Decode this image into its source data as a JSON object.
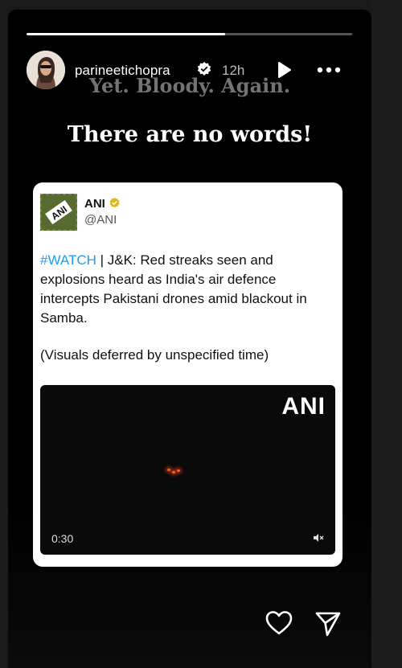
{
  "story": {
    "username": "parineetichopra",
    "time": "12h",
    "progress": 0.61,
    "caption_top": "Yet. Bloody. Again.",
    "caption_main": "There are no words!"
  },
  "tweet": {
    "name": "ANI",
    "handle": "@ANI",
    "hashtag": "#WATCH",
    "body": " | J&K: Red streaks seen and explosions heard as India's air defence intercepts Pakistani drones amid blackout in Samba.",
    "note": "(Visuals deferred by unspecified time)",
    "video": {
      "watermark": "ANI",
      "duration": "0:30"
    },
    "logo_text": "ANI"
  },
  "icons": {
    "verified": "verified-badge-icon",
    "play": "play-icon",
    "more": "more-icon",
    "heart": "heart-icon",
    "send": "send-icon",
    "mute": "mute-icon"
  },
  "colors": {
    "background": "#000000",
    "hashtag": "#1d9bf0",
    "verified_blue": "#3897f0",
    "gold_badge": "#e2b719"
  }
}
